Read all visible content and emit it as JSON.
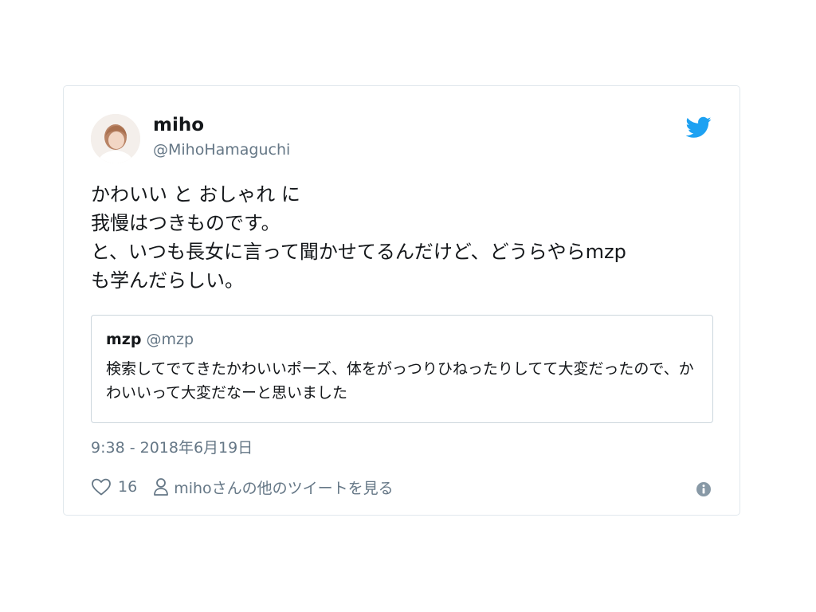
{
  "author": {
    "name": "miho",
    "handle": "@MihoHamaguchi",
    "avatar_icon": "profile-photo"
  },
  "tweet": {
    "text": "かわいい と おしゃれ に\n我慢はつきものです。\nと、いつも長女に言って聞かせてるんだけど、どうらやらmzp\nも学んだらしい。"
  },
  "quoted_tweet": {
    "name": "mzp",
    "handle": "@mzp",
    "text": "検索してでてきたかわいいポーズ、体をがっつりひねったりしてて大変だったので、かわいいって大変だなーと思いました"
  },
  "timestamp": "9:38 - 2018年6月19日",
  "actions": {
    "like_count": "16",
    "like_icon": "heart-icon",
    "others_icon": "person-icon",
    "others_label": "mihoさんの他のツイートを見る"
  },
  "icons": {
    "brand": "twitter-bird-icon",
    "info": "info-icon"
  },
  "colors": {
    "brand_blue": "#1da1f2",
    "secondary_text": "#657786",
    "border": "#e1e8ed"
  }
}
